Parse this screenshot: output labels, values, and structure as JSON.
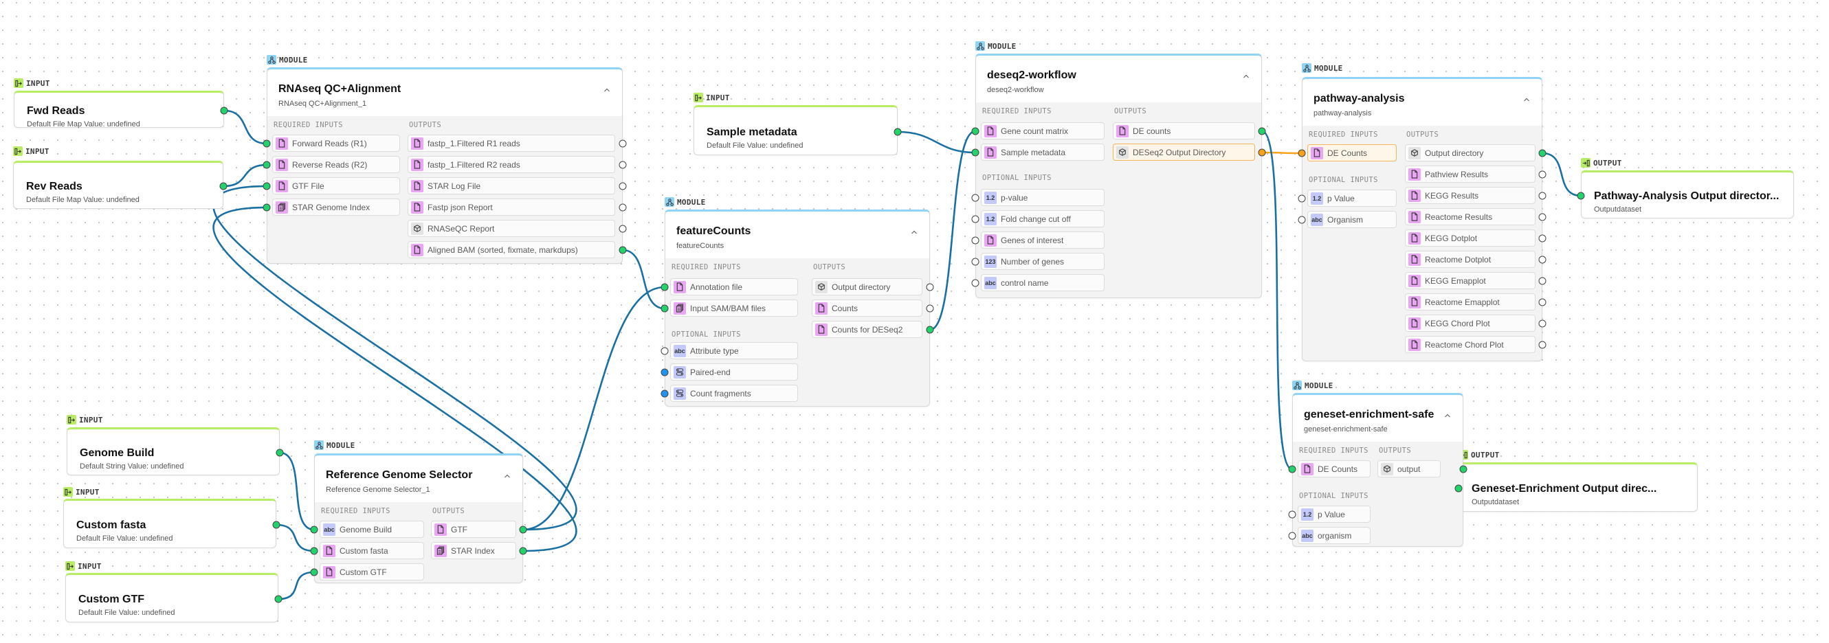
{
  "colors": {
    "edge": "#1a6fa3",
    "edge_active": "#f7a21b",
    "input_accent": "#b7ec64",
    "module_accent": "#8fd3f5",
    "connected_handle": "#22d36b",
    "default_handle": "#1e93f0",
    "file_badge": "#e9a6f2",
    "value_badge": "#c3c9fb"
  },
  "labels": {
    "input": "INPUT",
    "output": "OUTPUT",
    "module": "MODULE",
    "required_inputs": "REQUIRED INPUTS",
    "optional_inputs": "OPTIONAL INPUTS",
    "outputs": "OUTPUTS",
    "collapse": "^"
  },
  "inputs": [
    {
      "id": "fwd_reads",
      "title": "Fwd Reads",
      "subtitle": "Default File Map Value: undefined"
    },
    {
      "id": "rev_reads",
      "title": "Rev Reads",
      "subtitle": "Default File Map Value: undefined"
    },
    {
      "id": "sample_metadata",
      "title": "Sample metadata",
      "subtitle": "Default File Value: undefined"
    },
    {
      "id": "genome_build",
      "title": "Genome Build",
      "subtitle": "Default String Value: undefined"
    },
    {
      "id": "custom_fasta",
      "title": "Custom fasta",
      "subtitle": "Default File Value: undefined"
    },
    {
      "id": "custom_gtf",
      "title": "Custom GTF",
      "subtitle": "Default File Value: undefined"
    }
  ],
  "outputs": [
    {
      "id": "pathway_out",
      "title": "Pathway-Analysis Output director...",
      "subtitle": "Outputdataset"
    },
    {
      "id": "geneset_out",
      "title": "Geneset-Enrichment Output direc...",
      "subtitle": "Outputdataset"
    }
  ],
  "modules": {
    "rnaseq": {
      "title": "RNAseq QC+Alignment",
      "subtitle": "RNAseq QC+Alignment_1",
      "required_inputs": [
        {
          "label": "Forward Reads (R1)",
          "icon": "file-icon",
          "connected": true
        },
        {
          "label": "Reverse Reads (R2)",
          "icon": "file-icon",
          "connected": true
        },
        {
          "label": "GTF File",
          "icon": "file-icon",
          "connected": true
        },
        {
          "label": "STAR Genome Index",
          "icon": "files-icon",
          "connected": true
        }
      ],
      "outputs": [
        {
          "label": "fastp_1.Filtered R1 reads",
          "icon": "file-icon",
          "connected": false
        },
        {
          "label": "fastp_1.Filtered R2 reads",
          "icon": "file-icon",
          "connected": false
        },
        {
          "label": "STAR Log File",
          "icon": "file-icon",
          "connected": false
        },
        {
          "label": "Fastp json Report",
          "icon": "file-icon",
          "connected": false
        },
        {
          "label": "RNASeQC Report",
          "icon": "directory-icon",
          "connected": false
        },
        {
          "label": "Aligned BAM (sorted, fixmate, markdups)",
          "icon": "file-icon",
          "connected": true
        }
      ]
    },
    "featurecounts": {
      "title": "featureCounts",
      "subtitle": "featureCounts",
      "required_inputs": [
        {
          "label": "Annotation file",
          "icon": "file-icon",
          "connected": true
        },
        {
          "label": "Input SAM/BAM files",
          "icon": "files-icon",
          "connected": true
        }
      ],
      "optional_inputs": [
        {
          "label": "Attribute type",
          "icon": "string-icon",
          "badge": "abc",
          "state": "empty"
        },
        {
          "label": "Paired-end",
          "icon": "boolean-icon",
          "state": "default"
        },
        {
          "label": "Count fragments",
          "icon": "boolean-icon",
          "state": "default"
        }
      ],
      "outputs": [
        {
          "label": "Output directory",
          "icon": "directory-icon",
          "connected": false
        },
        {
          "label": "Counts",
          "icon": "file-icon",
          "connected": false
        },
        {
          "label": "Counts for DESeq2",
          "icon": "file-icon",
          "connected": true
        }
      ]
    },
    "deseq2": {
      "title": "deseq2-workflow",
      "subtitle": "deseq2-workflow",
      "required_inputs": [
        {
          "label": "Gene count matrix",
          "icon": "file-icon",
          "connected": true
        },
        {
          "label": "Sample metadata",
          "icon": "file-icon",
          "connected": true
        }
      ],
      "optional_inputs": [
        {
          "label": "p-value",
          "icon": "float-icon",
          "badge": "1.2"
        },
        {
          "label": "Fold change cut off",
          "icon": "float-icon",
          "badge": "1.2"
        },
        {
          "label": "Genes of interest",
          "icon": "file-icon"
        },
        {
          "label": "Number of genes",
          "icon": "integer-icon",
          "badge": "123"
        },
        {
          "label": "control name",
          "icon": "string-icon",
          "badge": "abc"
        }
      ],
      "outputs": [
        {
          "label": "DE counts",
          "icon": "file-icon",
          "connected": true
        },
        {
          "label": "DESeq2 Output Directory",
          "icon": "directory-icon",
          "connected": true,
          "highlighted": true
        }
      ]
    },
    "pathway": {
      "title": "pathway-analysis",
      "subtitle": "pathway-analysis",
      "required_inputs": [
        {
          "label": "DE Counts",
          "icon": "file-icon",
          "connected": true,
          "highlighted": true
        }
      ],
      "optional_inputs": [
        {
          "label": "p Value",
          "icon": "float-icon",
          "badge": "1.2"
        },
        {
          "label": "Organism",
          "icon": "string-icon",
          "badge": "abc"
        }
      ],
      "outputs": [
        {
          "label": "Output directory",
          "icon": "directory-icon",
          "connected": true
        },
        {
          "label": "Pathview Results",
          "icon": "file-icon",
          "connected": false
        },
        {
          "label": "KEGG Results",
          "icon": "file-icon",
          "connected": false
        },
        {
          "label": "Reactome Results",
          "icon": "file-icon",
          "connected": false
        },
        {
          "label": "KEGG Dotplot",
          "icon": "file-icon",
          "connected": false
        },
        {
          "label": "Reactome Dotplot",
          "icon": "file-icon",
          "connected": false
        },
        {
          "label": "KEGG Emapplot",
          "icon": "file-icon",
          "connected": false
        },
        {
          "label": "Reactome Emapplot",
          "icon": "file-icon",
          "connected": false
        },
        {
          "label": "KEGG Chord Plot",
          "icon": "file-icon",
          "connected": false
        },
        {
          "label": "Reactome Chord Plot",
          "icon": "file-icon",
          "connected": false
        }
      ]
    },
    "geneset": {
      "title": "geneset-enrichment-safe",
      "subtitle": "geneset-enrichment-safe",
      "required_inputs": [
        {
          "label": "DE Counts",
          "icon": "file-icon",
          "connected": true
        }
      ],
      "optional_inputs": [
        {
          "label": "p Value",
          "icon": "float-icon",
          "badge": "1.2"
        },
        {
          "label": "organism",
          "icon": "string-icon",
          "badge": "abc"
        }
      ],
      "outputs": [
        {
          "label": "output",
          "icon": "directory-icon",
          "connected": true
        }
      ]
    },
    "refgenome": {
      "title": "Reference Genome Selector",
      "subtitle": "Reference Genome Selector_1",
      "required_inputs": [
        {
          "label": "Genome Build",
          "icon": "string-icon",
          "badge": "abc",
          "connected": true
        },
        {
          "label": "Custom fasta",
          "icon": "file-icon",
          "connected": true
        },
        {
          "label": "Custom GTF",
          "icon": "file-icon",
          "connected": true
        }
      ],
      "outputs": [
        {
          "label": "GTF",
          "icon": "file-icon",
          "connected": true
        },
        {
          "label": "STAR Index",
          "icon": "files-icon",
          "connected": true
        }
      ]
    }
  },
  "connections": [
    {
      "from": "Fwd Reads",
      "to": "RNAseq QC+Alignment.Forward Reads (R1)"
    },
    {
      "from": "Rev Reads",
      "to": "RNAseq QC+Alignment.Reverse Reads (R2)"
    },
    {
      "from": "Reference Genome Selector.GTF",
      "to": "RNAseq QC+Alignment.GTF File"
    },
    {
      "from": "Reference Genome Selector.STAR Index",
      "to": "RNAseq QC+Alignment.STAR Genome Index"
    },
    {
      "from": "Reference Genome Selector.GTF",
      "to": "featureCounts.Annotation file"
    },
    {
      "from": "RNAseq QC+Alignment.Aligned BAM (sorted, fixmate, markdups)",
      "to": "featureCounts.Input SAM/BAM files"
    },
    {
      "from": "featureCounts.Counts for DESeq2",
      "to": "deseq2-workflow.Gene count matrix"
    },
    {
      "from": "Sample metadata",
      "to": "deseq2-workflow.Sample metadata"
    },
    {
      "from": "deseq2-workflow.DESeq2 Output Directory",
      "to": "pathway-analysis.DE Counts",
      "active": true
    },
    {
      "from": "deseq2-workflow.DE counts",
      "to": "geneset-enrichment-safe.DE Counts"
    },
    {
      "from": "pathway-analysis.Output directory",
      "to": "Pathway-Analysis Output director..."
    },
    {
      "from": "geneset-enrichment-safe.output",
      "to": "Geneset-Enrichment Output direc..."
    },
    {
      "from": "Genome Build",
      "to": "Reference Genome Selector.Genome Build"
    },
    {
      "from": "Custom fasta",
      "to": "Reference Genome Selector.Custom fasta"
    },
    {
      "from": "Custom GTF",
      "to": "Reference Genome Selector.Custom GTF"
    }
  ]
}
